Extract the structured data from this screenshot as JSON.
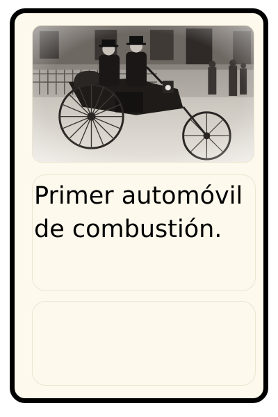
{
  "card": {
    "caption": "Primer automóvil de combustión."
  },
  "colors": {
    "card_background": "#fdf9ec",
    "card_border": "#000000",
    "panel_border": "#ece5d2"
  }
}
